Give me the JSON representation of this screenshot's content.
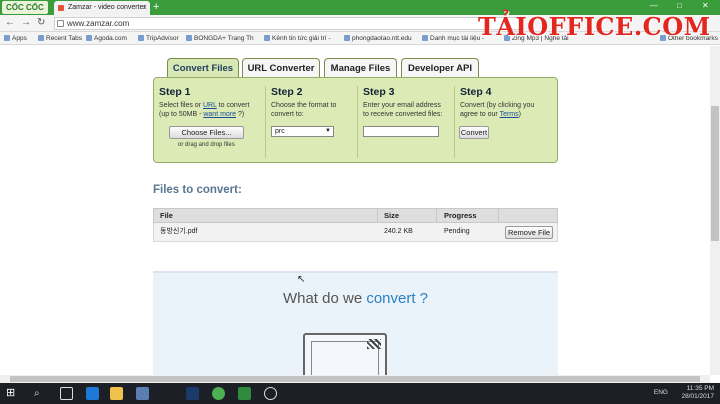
{
  "browser": {
    "logo": "CỐC CỐC",
    "tab_title": "Zamzar - video converter",
    "tab_close": "×",
    "new_tab": "+",
    "window_controls": [
      "—",
      "□",
      "✕"
    ],
    "url": "www.zamzar.com",
    "bookmarks": [
      "Apps",
      "Recent Tabs",
      "Agoda.com",
      "TripAdvisor",
      "BONGDA+ Trang Th",
      "Kênh tin tức giải trí -",
      "phongdaotao.ntt.edu",
      "Danh mục tài liệu -",
      "Zing Mp3 | Nghe tải",
      "Other bookmarks"
    ]
  },
  "watermark": "TẢIOFFICE.COM",
  "tabs": [
    "Convert Files",
    "URL Converter",
    "Manage Files",
    "Developer API"
  ],
  "steps": [
    {
      "title": "Step 1",
      "text_a": "Select files or ",
      "link1": "URL",
      "text_b": " to convert (up to 50MB - ",
      "link2": "want more",
      "text_c": " ?)",
      "button": "Choose Files...",
      "drop": "or drag and drop files"
    },
    {
      "title": "Step 2",
      "text": "Choose the format to convert to:",
      "select_value": "prc"
    },
    {
      "title": "Step 3",
      "text": "Enter your email address to receive converted files:"
    },
    {
      "title": "Step 4",
      "text_a": "Convert (by clicking you agree to our ",
      "link": "Terms",
      "text_b": ")",
      "button": "Convert"
    }
  ],
  "files_heading": "Files to convert:",
  "table": {
    "headers": [
      "File",
      "Size",
      "Progress"
    ],
    "rows": [
      {
        "file": "동방신기.pdf",
        "size": "240.2 KB",
        "progress": "Pending",
        "action": "Remove File"
      }
    ]
  },
  "promo": {
    "title_a": "What do we ",
    "title_b": "convert ?"
  },
  "taskbar": {
    "lang": "ENG",
    "time": "11:35 PM",
    "date": "28/01/2017"
  }
}
